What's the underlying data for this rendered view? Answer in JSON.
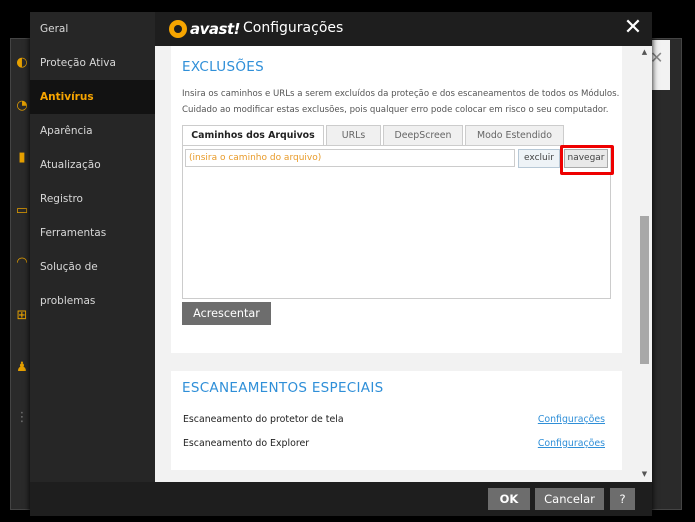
{
  "app": {
    "logo_text": "avast!",
    "title": "Configurações"
  },
  "background": {
    "icons": [
      "shield-icon",
      "gear-icon",
      "lock-icon",
      "box-icon",
      "sync-icon",
      "wrench-icon",
      "person-icon",
      "dots-icon"
    ]
  },
  "sidebar": {
    "items": [
      {
        "label": "Geral",
        "active": false
      },
      {
        "label": "Proteção Ativa",
        "active": false
      },
      {
        "label": "Antivírus",
        "active": true
      },
      {
        "label": "Aparência",
        "active": false
      },
      {
        "label": "Atualização",
        "active": false
      },
      {
        "label": "Registro",
        "active": false
      },
      {
        "label": "Ferramentas",
        "active": false
      },
      {
        "label": "Solução de problemas",
        "active": false
      }
    ]
  },
  "exclusions": {
    "title": "EXCLUSÕES",
    "description_line1": "Insira os caminhos e URLs a serem excluídos da proteção e dos escaneamentos de todos os Módulos.",
    "description_line2": "Cuidado ao modificar estas exclusões, pois qualquer erro pode colocar em risco o seu computador.",
    "tabs": [
      {
        "label": "Caminhos dos Arquivos",
        "active": true
      },
      {
        "label": "URLs",
        "active": false
      },
      {
        "label": "DeepScreen",
        "active": false
      },
      {
        "label": "Modo Estendido",
        "active": false
      }
    ],
    "path_placeholder": "(insira o caminho do arquivo)",
    "delete_label": "excluir",
    "browse_label": "navegar",
    "add_label": "Acrescentar"
  },
  "special_scans": {
    "title": "ESCANEAMENTOS ESPECIAIS",
    "rows": [
      {
        "label": "Escaneamento do protetor de tela",
        "link": "Configurações"
      },
      {
        "label": "Escaneamento do Explorer",
        "link": "Configurações"
      }
    ]
  },
  "footer": {
    "ok_label": "OK",
    "cancel_label": "Cancelar",
    "help_label": "?"
  },
  "colors": {
    "accent": "#f7a500",
    "link": "#2f8fd8",
    "highlight": "#e00000"
  }
}
